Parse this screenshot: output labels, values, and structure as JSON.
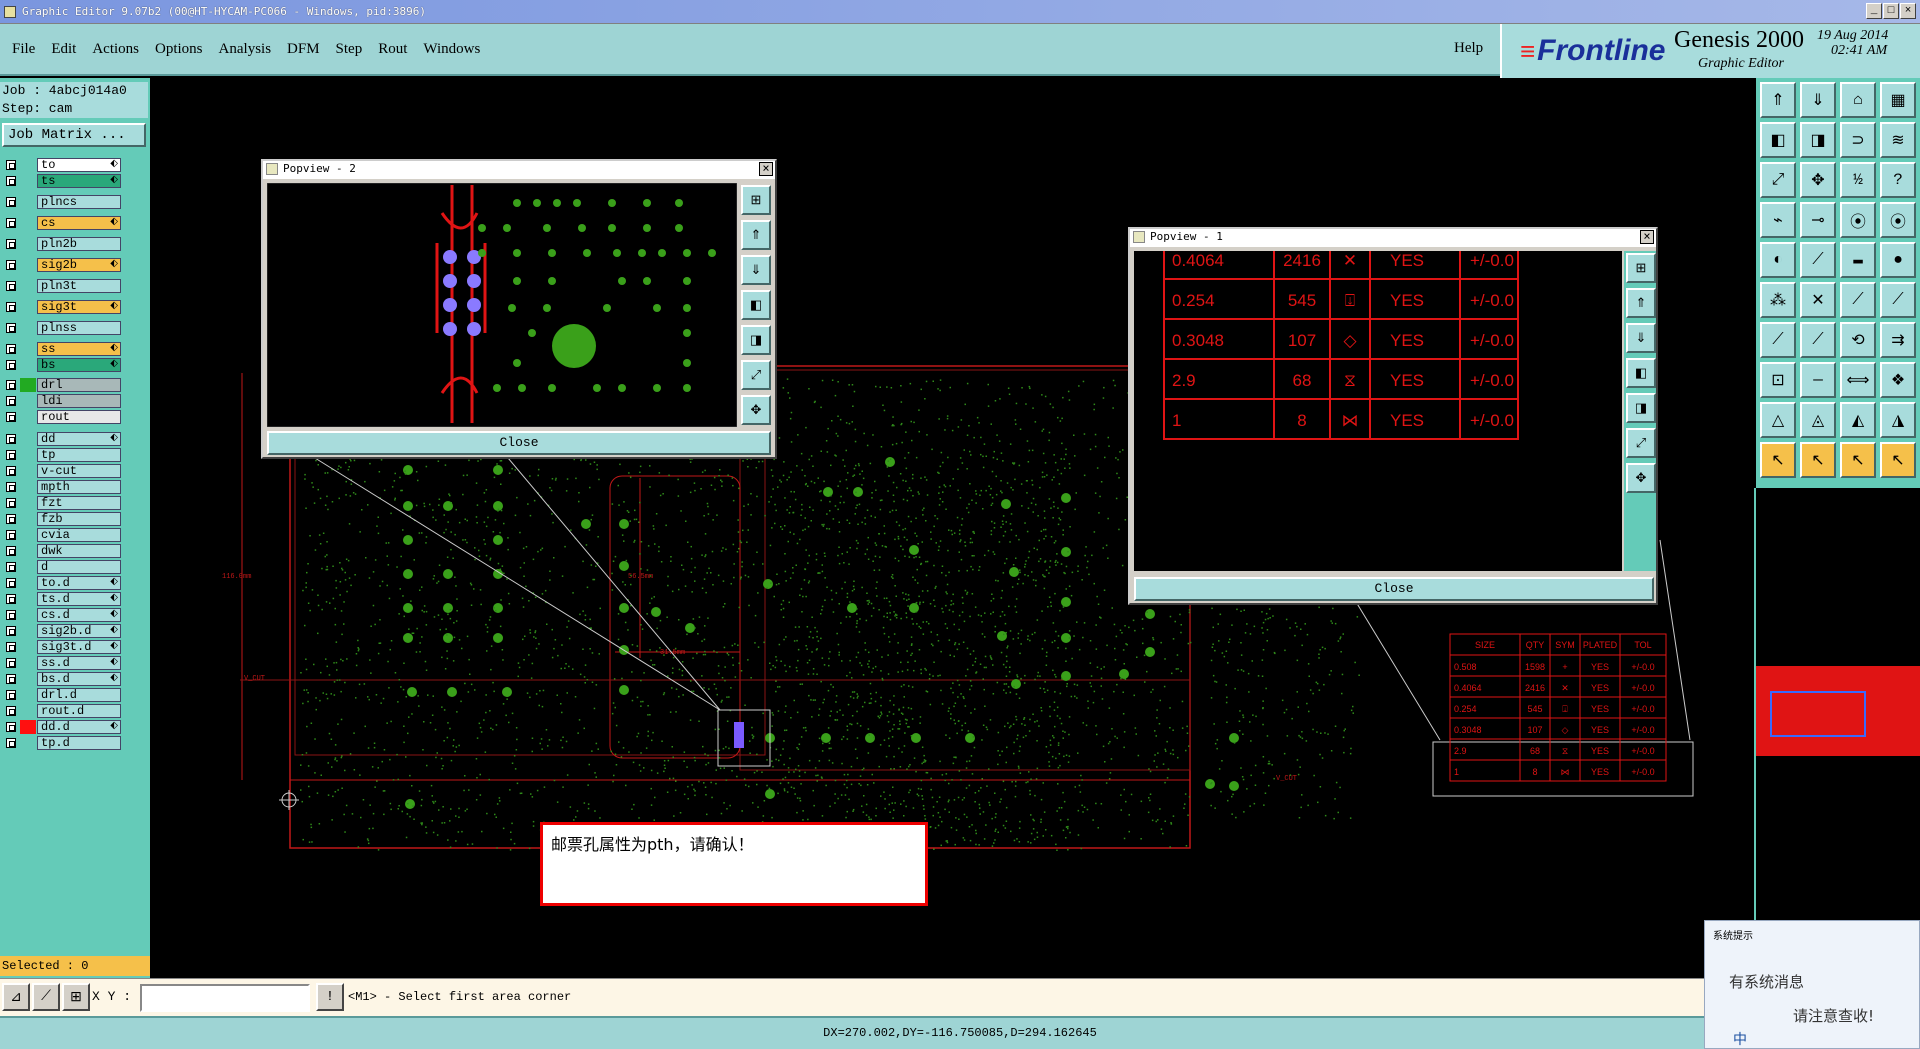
{
  "window": {
    "title": "Graphic Editor 9.07b2 (00@HT-HYCAM-PC066 - Windows, pid:3896)"
  },
  "menu": {
    "items": [
      "File",
      "Edit",
      "Actions",
      "Options",
      "Analysis",
      "DFM",
      "Step",
      "Rout",
      "Windows"
    ],
    "help": "Help"
  },
  "brand": {
    "logo": "Frontline",
    "product": "Genesis 2000",
    "subtitle": "Graphic Editor",
    "date": "19 Aug 2014",
    "time": "02:41 AM"
  },
  "job": {
    "job_line": "Job : 4abcj014a0",
    "step_line": "Step: cam",
    "matrix_button": "Job Matrix ..."
  },
  "layers": [
    {
      "name": "to",
      "color": "#ffffff",
      "flag": "⬖"
    },
    {
      "name": "ts",
      "color": "#2aa87a",
      "flag": "⬖"
    },
    {
      "name": "plncs",
      "color": "#a8dcdc",
      "flag": ""
    },
    {
      "name": "cs",
      "color": "#f5c04a",
      "flag": "⬖"
    },
    {
      "name": "pln2b",
      "color": "#a8dcdc",
      "flag": ""
    },
    {
      "name": "sig2b",
      "color": "#f5c04a",
      "flag": "⬖"
    },
    {
      "name": "pln3t",
      "color": "#a8dcdc",
      "flag": ""
    },
    {
      "name": "sig3t",
      "color": "#f5c04a",
      "flag": "⬖"
    },
    {
      "name": "plnss",
      "color": "#a8dcdc",
      "flag": ""
    },
    {
      "name": "ss",
      "color": "#f5c04a",
      "flag": "⬖"
    },
    {
      "name": "bs",
      "color": "#2aa87a",
      "flag": "⬖"
    },
    {
      "name": "drl",
      "color": "#a8b8b8",
      "flag": "",
      "swatch": "#22aa22"
    },
    {
      "name": "ldi",
      "color": "#a8b8b8",
      "flag": ""
    },
    {
      "name": "rout",
      "color": "#e8e8e8",
      "flag": ""
    },
    {
      "name": "dd",
      "color": "#a8dcdc",
      "flag": "⬖"
    },
    {
      "name": "tp",
      "color": "#a8dcdc",
      "flag": ""
    },
    {
      "name": "v-cut",
      "color": "#a8dcdc",
      "flag": ""
    },
    {
      "name": "mpth",
      "color": "#a8dcdc",
      "flag": ""
    },
    {
      "name": "fzt",
      "color": "#a8dcdc",
      "flag": ""
    },
    {
      "name": "fzb",
      "color": "#a8dcdc",
      "flag": ""
    },
    {
      "name": "cvia",
      "color": "#a8dcdc",
      "flag": ""
    },
    {
      "name": "dwk",
      "color": "#a8dcdc",
      "flag": ""
    },
    {
      "name": "d",
      "color": "#a8dcdc",
      "flag": ""
    },
    {
      "name": "to.d",
      "color": "#a8dcdc",
      "flag": "⬖"
    },
    {
      "name": "ts.d",
      "color": "#a8dcdc",
      "flag": "⬖"
    },
    {
      "name": "cs.d",
      "color": "#a8dcdc",
      "flag": "⬖"
    },
    {
      "name": "sig2b.d",
      "color": "#a8dcdc",
      "flag": "⬖"
    },
    {
      "name": "sig3t.d",
      "color": "#a8dcdc",
      "flag": "⬖"
    },
    {
      "name": "ss.d",
      "color": "#a8dcdc",
      "flag": "⬖"
    },
    {
      "name": "bs.d",
      "color": "#a8dcdc",
      "flag": "⬖"
    },
    {
      "name": "drl.d",
      "color": "#a8dcdc",
      "flag": ""
    },
    {
      "name": "rout.d",
      "color": "#a8dcdc",
      "flag": ""
    },
    {
      "name": "dd.d",
      "color": "#a8dcdc",
      "flag": "⬖",
      "swatch": "#ff1010"
    },
    {
      "name": "tp.d",
      "color": "#a8dcdc",
      "flag": ""
    }
  ],
  "selected": "Selected : 0",
  "popview2": {
    "title": "Popview - 2",
    "close": "Close"
  },
  "popview1": {
    "title": "Popview - 1",
    "close": "Close",
    "rows": [
      {
        "size": "0.4064",
        "qty": "2416",
        "sym": "✕",
        "plated": "YES",
        "tol": "+/-0.0"
      },
      {
        "size": "0.254",
        "qty": "545",
        "sym": "⍗",
        "plated": "YES",
        "tol": "+/-0.0"
      },
      {
        "size": "0.3048",
        "qty": "107",
        "sym": "◇",
        "plated": "YES",
        "tol": "+/-0.0"
      },
      {
        "size": "2.9",
        "qty": "68",
        "sym": "⧖",
        "plated": "YES",
        "tol": "+/-0.0"
      },
      {
        "size": "1",
        "qty": "8",
        "sym": "⋈",
        "plated": "YES",
        "tol": "+/-0.0"
      }
    ]
  },
  "drill_table": {
    "headers": [
      "SIZE",
      "QTY",
      "SYM",
      "PLATED",
      "TOL"
    ],
    "rows": [
      [
        "0.508",
        "1598",
        "+",
        "YES",
        "+/-0.0"
      ],
      [
        "0.4064",
        "2416",
        "✕",
        "YES",
        "+/-0.0"
      ],
      [
        "0.254",
        "545",
        "⍗",
        "YES",
        "+/-0.0"
      ],
      [
        "0.3048",
        "107",
        "◇",
        "YES",
        "+/-0.0"
      ],
      [
        "2.9",
        "68",
        "⧖",
        "YES",
        "+/-0.0"
      ],
      [
        "1",
        "8",
        "⋈",
        "YES",
        "+/-0.0"
      ]
    ]
  },
  "dimensions": {
    "d1": "116.0mm",
    "d2": "56.5mm",
    "d3": "31.5mm",
    "vcut_left": "V_CUT",
    "vcut_right": "V_CUT"
  },
  "message": "邮票孔属性为pth，请确认！",
  "bottom": {
    "xy_label": "X Y :",
    "xy_value": "",
    "hint": "<M1> - Select first area corner"
  },
  "status": "DX=270.002,DY=-116.750085,D=294.162645",
  "notification": {
    "header": "系统提示",
    "line1": "有系统消息",
    "line2": "请注意查收!",
    "ime": "中"
  }
}
